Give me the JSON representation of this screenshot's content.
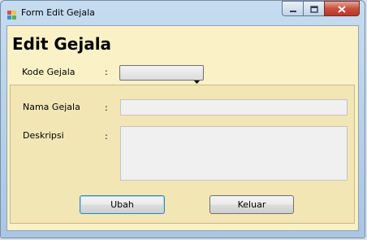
{
  "window": {
    "title": "Form Edit Gejala"
  },
  "form": {
    "heading": "Edit Gejala",
    "kode_gejala_label": "Kode Gejala",
    "kode_gejala_colon": ":",
    "kode_gejala_value": "",
    "nama_gejala_label": "Nama Gejala",
    "nama_gejala_colon": ":",
    "nama_gejala_value": "",
    "deskripsi_label": "Deskripsi",
    "deskripsi_colon": ":",
    "deskripsi_value": ""
  },
  "buttons": {
    "ubah": "Ubah",
    "keluar": "Keluar"
  },
  "colors": {
    "form_background": "#fbf1c6",
    "group_background": "#f3e6b5",
    "close_button": "#c7503f"
  },
  "icons": {
    "app": "form-app-icon",
    "minimize": "minimize-icon",
    "maximize": "maximize-icon",
    "close": "close-icon",
    "dropdown": "chevron-down-icon"
  }
}
